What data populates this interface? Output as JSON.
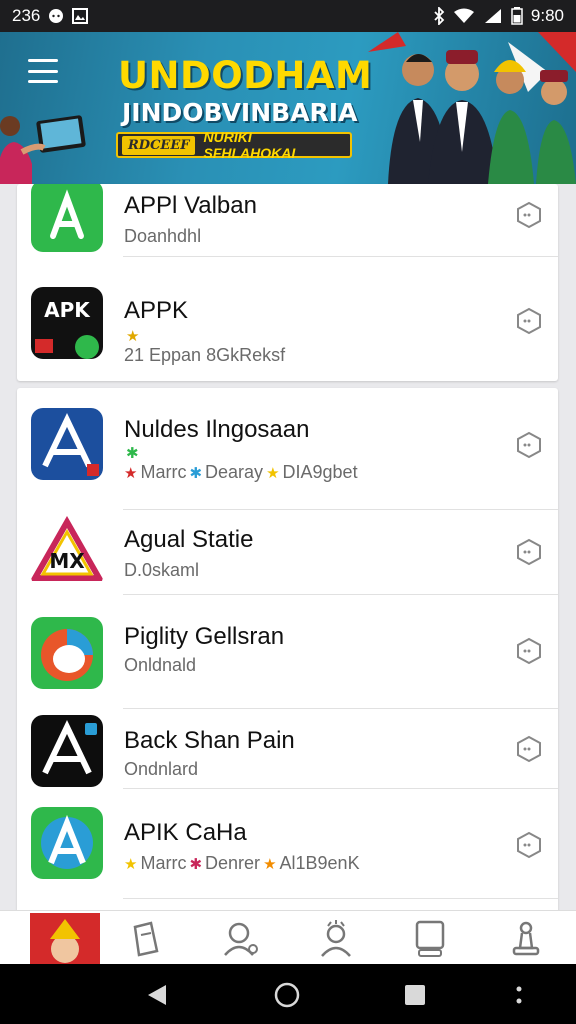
{
  "status_bar": {
    "left_text": "236",
    "time": "9:80",
    "icons": [
      "notification-icon",
      "photo-icon",
      "bluetooth-icon",
      "wifi-icon",
      "signal-icon",
      "battery-icon"
    ]
  },
  "banner": {
    "title": "UNDODHAM",
    "subtitle": "JINDOBVINBARIA",
    "tag": "RDCEEF",
    "strip_text": "NURIKI SFHLAHOKAI"
  },
  "apps_group1": [
    {
      "name": "APPl Valban",
      "sub": "Doanhdhl",
      "icon": "green-a-icon"
    },
    {
      "name": "APPK",
      "sub": "21 Eppan 8GkReksf",
      "icon": "apk-black-icon"
    }
  ],
  "apps_group2": [
    {
      "name": "Nuldes Ilngosaan",
      "sub_parts": [
        "Marrc",
        "Dearay",
        "DIA9gbet"
      ],
      "icon": "blue-a-icon"
    },
    {
      "name": "Agual Statie",
      "sub": "D.0skaml",
      "icon": "triangle-mx-icon"
    },
    {
      "name": "Piglity Gellsran",
      "sub": "Onldnald",
      "icon": "orange-green-circle-icon"
    },
    {
      "name": "Back Shan Pain",
      "sub": "Ondnlard",
      "icon": "black-a-icon"
    },
    {
      "name": "APIK CaHa",
      "sub_parts": [
        "Marrc",
        "Denrer",
        "Al1B9enK"
      ],
      "icon": "green-blue-a-icon"
    }
  ],
  "colors": {
    "banner_blue": "#2a90b5",
    "banner_yellow": "#ffd900",
    "green_app": "#2fb84b",
    "blue_app": "#1c4f9e"
  }
}
